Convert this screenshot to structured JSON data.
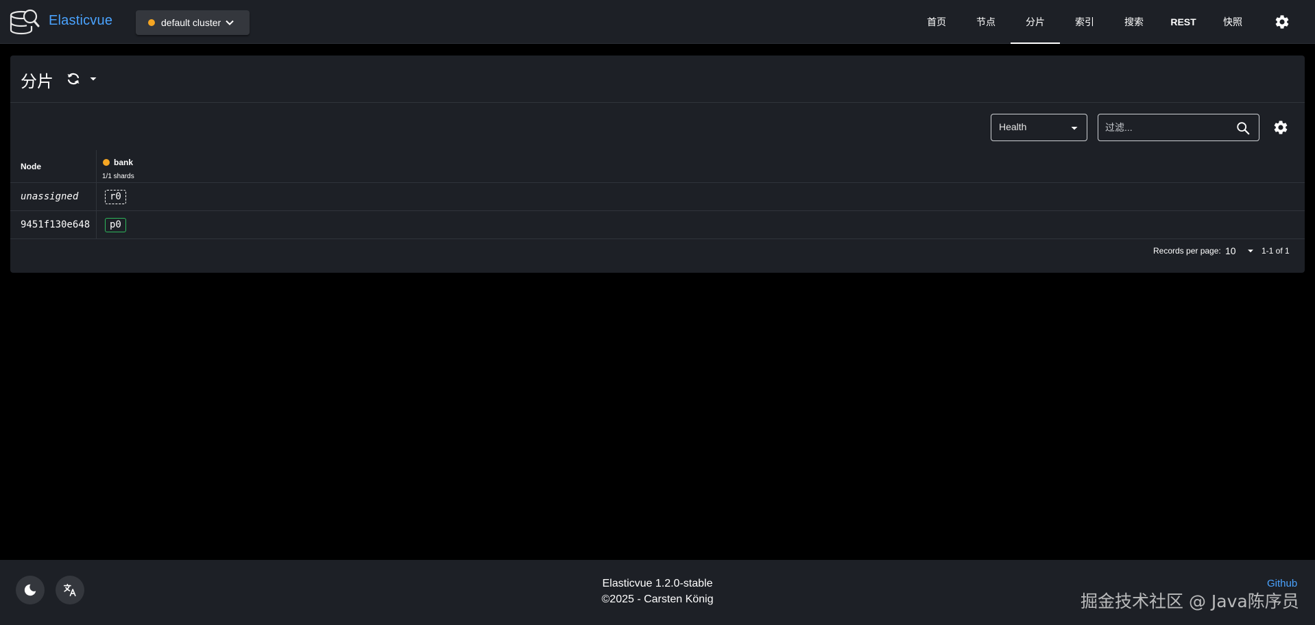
{
  "header": {
    "brand": "Elasticvue",
    "cluster": {
      "label": "default cluster",
      "status_color": "#f5a623"
    },
    "nav": [
      {
        "label": "首页",
        "active": false
      },
      {
        "label": "节点",
        "active": false
      },
      {
        "label": "分片",
        "active": true
      },
      {
        "label": "索引",
        "active": false
      },
      {
        "label": "搜索",
        "active": false
      },
      {
        "label": "REST",
        "active": false
      },
      {
        "label": "快照",
        "active": false
      }
    ],
    "settings_icon": "gear-icon"
  },
  "page": {
    "title": "分片",
    "refresh_icon": "refresh-icon"
  },
  "toolbar": {
    "health_select": {
      "value": "Health"
    },
    "filter": {
      "placeholder": "过滤...",
      "value": ""
    }
  },
  "table": {
    "node_header": "Node",
    "indices": [
      {
        "name": "bank",
        "status_color": "#f5a623",
        "shards_text": "1/1 shards"
      }
    ],
    "rows": [
      {
        "node": "unassigned",
        "shard": "r0",
        "shard_type": "replica"
      },
      {
        "node": "9451f130e648",
        "shard": "p0",
        "shard_type": "primary"
      }
    ]
  },
  "pagination": {
    "records_per_page_label": "Records per page:",
    "records_per_page": "10",
    "range": "1-1 of 1"
  },
  "footer": {
    "version": "Elasticvue 1.2.0-stable",
    "copyright": "©2025 - Carsten König",
    "github": "Github",
    "watermark": "掘金技术社区 @ Java陈序员"
  },
  "colors": {
    "accent": "#4aa3ff",
    "background": "#000000",
    "surface": "#1d2026",
    "yellow_status": "#f5a623",
    "primary_shard": "#2eb85c"
  }
}
